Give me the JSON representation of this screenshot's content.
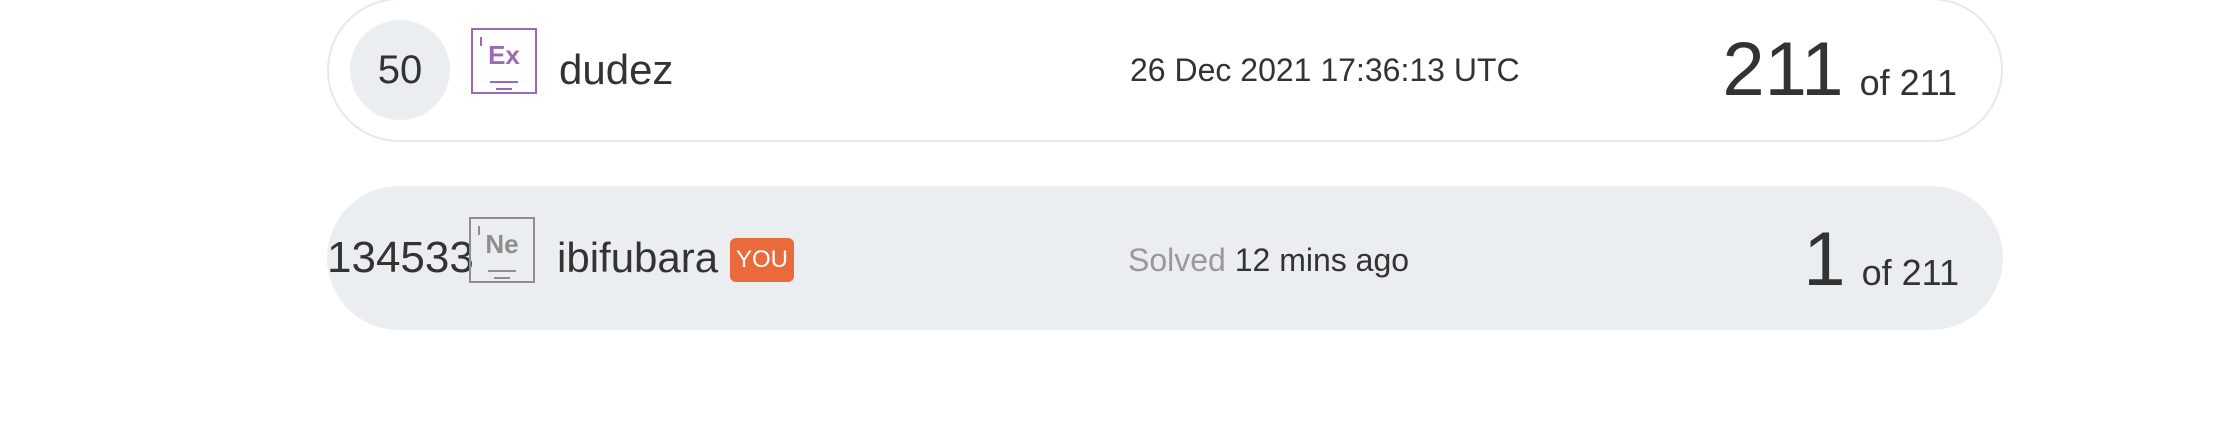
{
  "rows": [
    {
      "rank": "50",
      "element_symbol": "Ex",
      "username": "dudez",
      "time": "26 Dec 2021 17:36:13 UTC",
      "score": "211",
      "score_of": "of 211",
      "badge_color": "#9a6ab6"
    },
    {
      "rank": "134533",
      "element_symbol": "Ne",
      "username": "ibifubara",
      "you_label": "YOU",
      "time_label": "Solved",
      "time": "12 mins ago",
      "score": "1",
      "score_of": "of 211",
      "badge_color": "#8e8e8e",
      "you_color": "#ea6a3c"
    }
  ]
}
